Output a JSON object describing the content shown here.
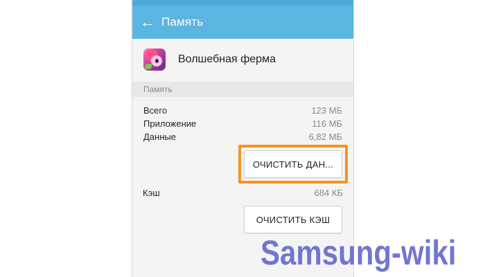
{
  "statusbar": {
    "text": ""
  },
  "appbar": {
    "back_icon": "arrow-left-icon",
    "title": "Память"
  },
  "app": {
    "name": "Волшебная ферма",
    "icon": "app-icon-pony"
  },
  "memory": {
    "section_header": "Память",
    "rows": [
      {
        "label": "Всего",
        "value": "123 МБ"
      },
      {
        "label": "Приложение",
        "value": "116 МБ"
      },
      {
        "label": "Данные",
        "value": "6,82 МБ"
      }
    ],
    "clear_data_button": "ОЧИСТИТЬ ДАН...",
    "cache_label": "Кэш",
    "cache_value": "684 КБ",
    "clear_cache_button": "ОЧИСТИТЬ КЭШ"
  },
  "watermark": "Samsung-wiki",
  "colors": {
    "appbar": "#5bb5e0",
    "highlight": "#f7941d",
    "watermark": "#5a5fc8"
  }
}
